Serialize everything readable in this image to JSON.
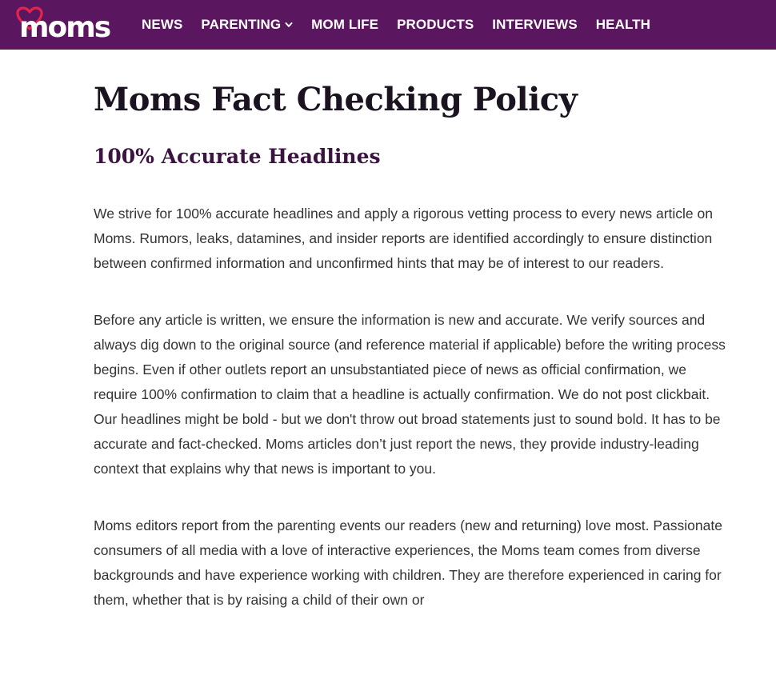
{
  "header": {
    "logo_text": "moms",
    "nav": [
      {
        "label": "NEWS"
      },
      {
        "label": "PARENTING",
        "has_dropdown": true
      },
      {
        "label": "MOM LIFE"
      },
      {
        "label": "PRODUCTS"
      },
      {
        "label": "INTERVIEWS"
      },
      {
        "label": "HEALTH"
      }
    ]
  },
  "main": {
    "title": "Moms Fact Checking Policy",
    "section_heading": "100% Accurate Headlines",
    "paragraphs": [
      "We strive for 100% accurate headlines and apply a rigorous vetting process to every news article on Moms. Rumors, leaks, datamines, and insider reports are identified accordingly to ensure distinction between confirmed information and unconfirmed hints that may be of interest to our readers.",
      "Before any article is written, we ensure the information is new and accurate. We verify sources and always dig down to the original source (and reference material if applicable) before the writing process begins. Even if other outlets report an unsubstantiated piece of news as official confirmation, we require 100% confirmation to claim that a headline is actually confirmation. We do not post clickbait. Our headlines might be bold - but we don't throw out broad statements just to sound bold. It has to be accurate and fact-checked. Moms articles don’t just report the news, they provide industry-leading context that explains why that news is important to you.",
      "Moms editors report from the parenting events our readers (new and returning) love most. Passionate consumers of all media with a love of interactive experiences, the Moms team comes from diverse backgrounds and have experience working with children. They are therefore experienced in caring for them, whether that is by raising a child of their own or"
    ]
  },
  "colors": {
    "header_bg": "#5b1660",
    "heart": "#e8234a",
    "title_text": "#1b1320",
    "heading_text": "#3a1340",
    "body_text": "#333333"
  },
  "icons": {
    "logo_heart": "heart-icon",
    "dropdown": "chevron-down-icon"
  }
}
